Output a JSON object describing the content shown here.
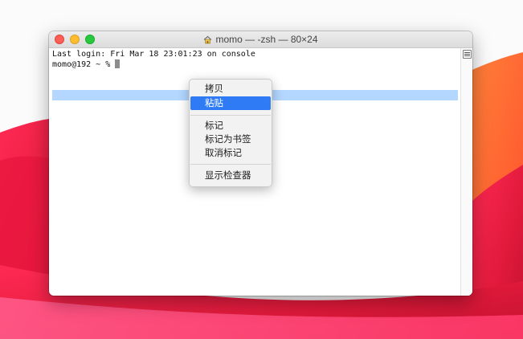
{
  "window": {
    "title": "momo — -zsh — 80×24",
    "title_icon": "home-folder-icon"
  },
  "terminal": {
    "last_login": "Last login: Fri Mar 18 23:01:23 on console",
    "prompt": "momo@192 ~ % "
  },
  "context_menu": {
    "copy": "拷贝",
    "paste": "粘贴",
    "mark": "标记",
    "bookmark": "标记为书签",
    "unmark": "取消标记",
    "inspector": "显示检查器"
  },
  "colors": {
    "selection": "#b3d7ff",
    "menu_highlight": "#2f7bf5",
    "close": "#fd5f57",
    "minimize": "#febc2e",
    "maximize": "#28c840"
  },
  "icons": {
    "scrollbar_split": "split-pane-icon"
  }
}
